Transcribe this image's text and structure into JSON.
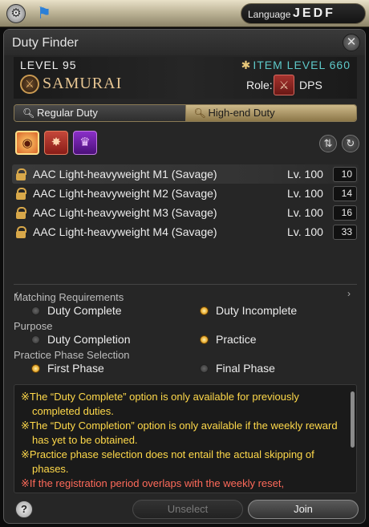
{
  "topbar": {
    "language_label": "Language",
    "language_codes": "JEDF"
  },
  "window": {
    "title": "Duty Finder"
  },
  "job": {
    "level": "LEVEL 95",
    "name": "SAMURAI",
    "item_level": "ITEM LEVEL 660",
    "role_label": "Role:",
    "role_name": "DPS"
  },
  "tabs": [
    {
      "label": "Regular Duty",
      "selected": false
    },
    {
      "label": "High-end Duty",
      "selected": true
    }
  ],
  "duties": [
    {
      "name": "AAC Light-heavyweight M1 (Savage)",
      "level": "Lv. 100",
      "count": "10"
    },
    {
      "name": "AAC Light-heavyweight M2 (Savage)",
      "level": "Lv. 100",
      "count": "14"
    },
    {
      "name": "AAC Light-heavyweight M3 (Savage)",
      "level": "Lv. 100",
      "count": "16"
    },
    {
      "name": "AAC Light-heavyweight M4 (Savage)",
      "level": "Lv. 100",
      "count": "33"
    }
  ],
  "options": {
    "matching": {
      "heading": "Matching Requirements",
      "opt_a": "Duty Complete",
      "opt_b": "Duty Incomplete",
      "selected": "Duty Incomplete"
    },
    "purpose": {
      "heading": "Purpose",
      "opt_a": "Duty Completion",
      "opt_b": "Practice",
      "selected": "Practice"
    },
    "phase": {
      "heading": "Practice Phase Selection",
      "opt_a": "First Phase",
      "opt_b": "Final Phase",
      "selected": "First Phase"
    }
  },
  "notes": [
    {
      "text": "※The “Duty Complete” option is only available for previously completed duties.",
      "color": "#ffd94a"
    },
    {
      "text": "※The “Duty Completion” option is only available if the weekly reward has yet to be obtained.",
      "color": "#ffd94a"
    },
    {
      "text": "※Practice phase selection does not entail the actual skipping of phases.",
      "color": "#ffd94a"
    },
    {
      "text": "※If the registration period overlaps with the weekly reset,",
      "color": "#ff6a5a"
    }
  ],
  "footer": {
    "help": "?",
    "unselect_label": "Unselect",
    "join_label": "Join"
  },
  "icons": {
    "top_left": "gear-icon",
    "top_second": "flag-icon",
    "close": "crossed-swords-close-icon",
    "job": "samurai-job-icon",
    "role": "dps-sword-icon",
    "category_1": "raid-icon",
    "category_2": "trial-icon",
    "category_3": "alliance-raid-icon",
    "sort": "sort-icon",
    "refresh": "refresh-icon"
  }
}
